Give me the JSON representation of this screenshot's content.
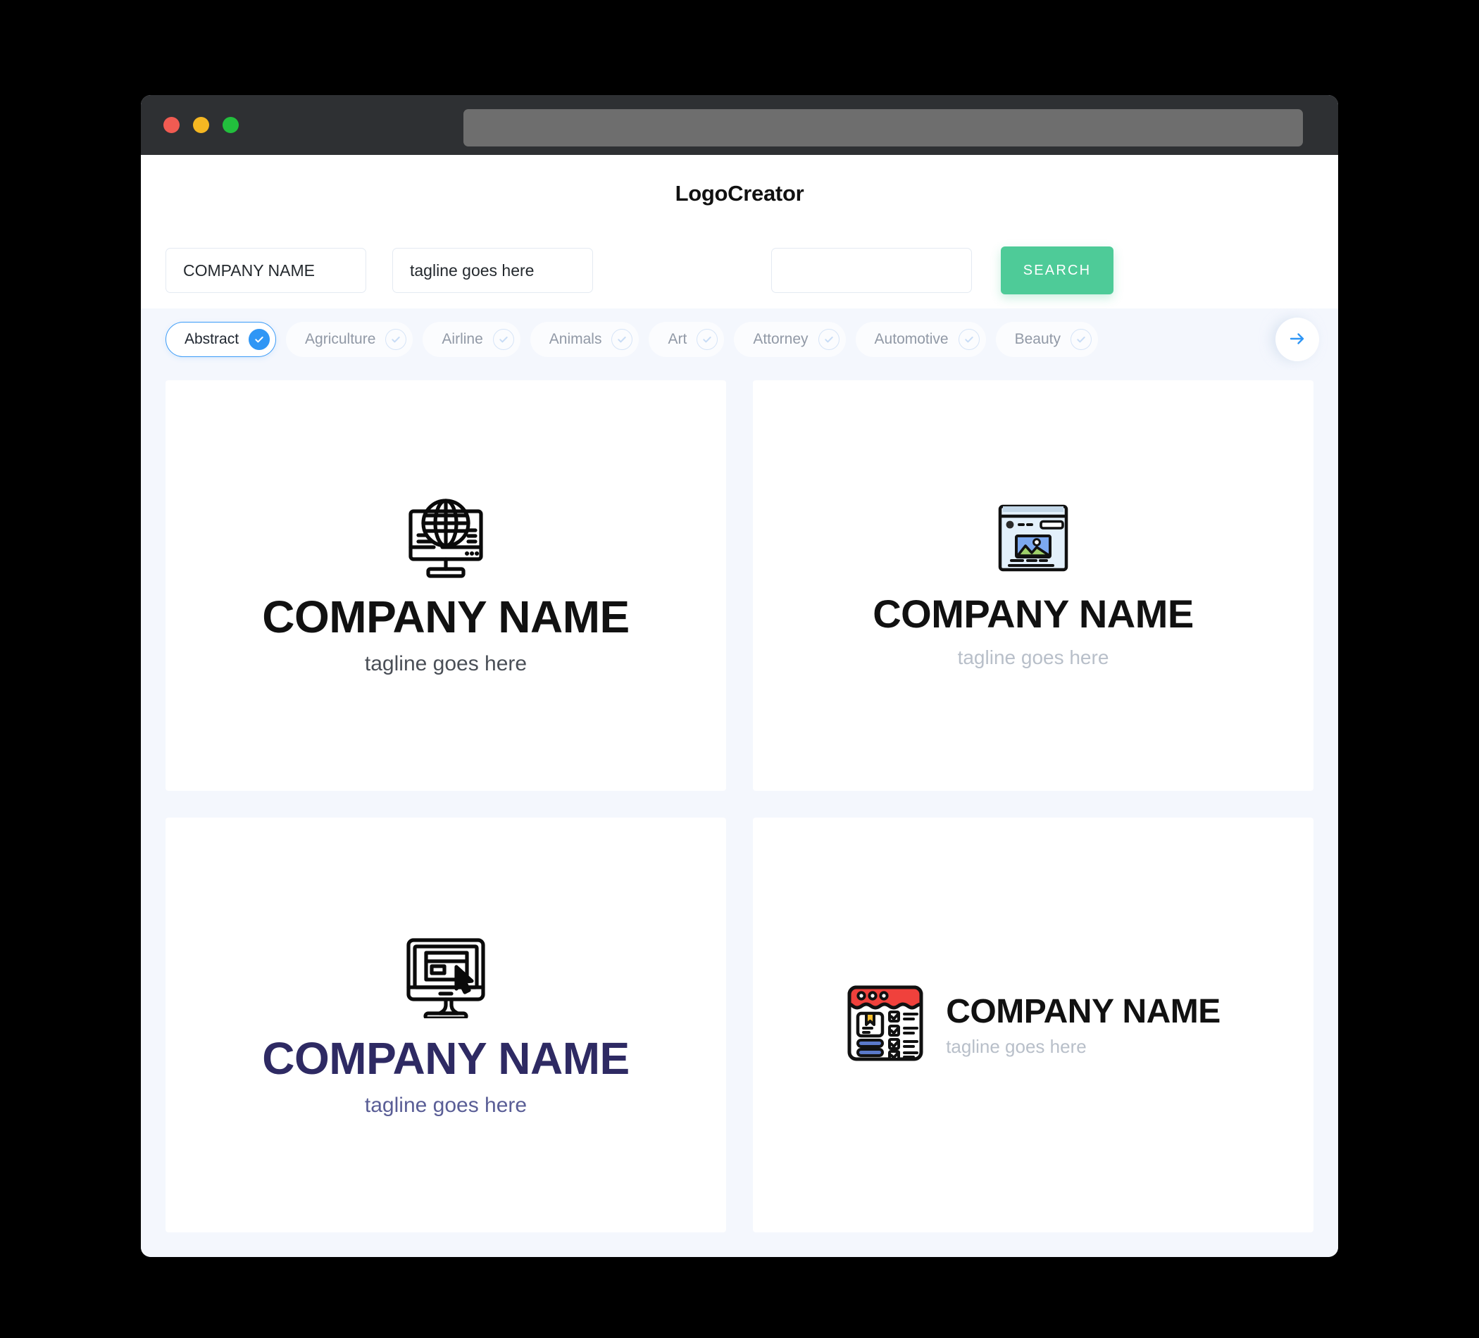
{
  "window": {
    "traffic_lights": [
      {
        "name": "close",
        "color": "#f15b52"
      },
      {
        "name": "minimize",
        "color": "#f5b722"
      },
      {
        "name": "maximize",
        "color": "#22bf3d"
      }
    ],
    "url_value": ""
  },
  "header": {
    "title": "LogoCreator"
  },
  "search": {
    "company_value": "COMPANY NAME",
    "company_placeholder": "COMPANY NAME",
    "tagline_value": "tagline goes here",
    "tagline_placeholder": "tagline goes here",
    "extra_value": "",
    "extra_placeholder": "",
    "search_label": "SEARCH",
    "search_color": "#4ecb98"
  },
  "categories": {
    "selected": "Abstract",
    "accent": "#2f96f5",
    "next_icon": "arrow-right-icon",
    "items": [
      {
        "label": "Abstract",
        "selected": true
      },
      {
        "label": "Agriculture",
        "selected": false
      },
      {
        "label": "Airline",
        "selected": false
      },
      {
        "label": "Animals",
        "selected": false
      },
      {
        "label": "Art",
        "selected": false
      },
      {
        "label": "Attorney",
        "selected": false
      },
      {
        "label": "Automotive",
        "selected": false
      },
      {
        "label": "Beauty",
        "selected": false
      }
    ]
  },
  "results": {
    "cards": [
      {
        "icon": "monitor-globe-icon",
        "name": "COMPANY NAME",
        "tagline": "tagline goes here",
        "name_color": "#111111",
        "tagline_color": "#4a4f57",
        "layout": "stacked"
      },
      {
        "icon": "browser-image-icon",
        "name": "COMPANY NAME",
        "tagline": "tagline goes here",
        "name_color": "#111111",
        "tagline_color": "#b8bfc9",
        "layout": "stacked"
      },
      {
        "icon": "monitor-cursor-icon",
        "name": "COMPANY NAME",
        "tagline": "tagline goes here",
        "name_color": "#2e2a63",
        "tagline_color": "#5a5e96",
        "layout": "stacked"
      },
      {
        "icon": "checklist-browser-icon",
        "name": "COMPANY NAME",
        "tagline": "tagline goes here",
        "name_color": "#111111",
        "tagline_color": "#b8bfc9",
        "layout": "horizontal"
      }
    ]
  }
}
